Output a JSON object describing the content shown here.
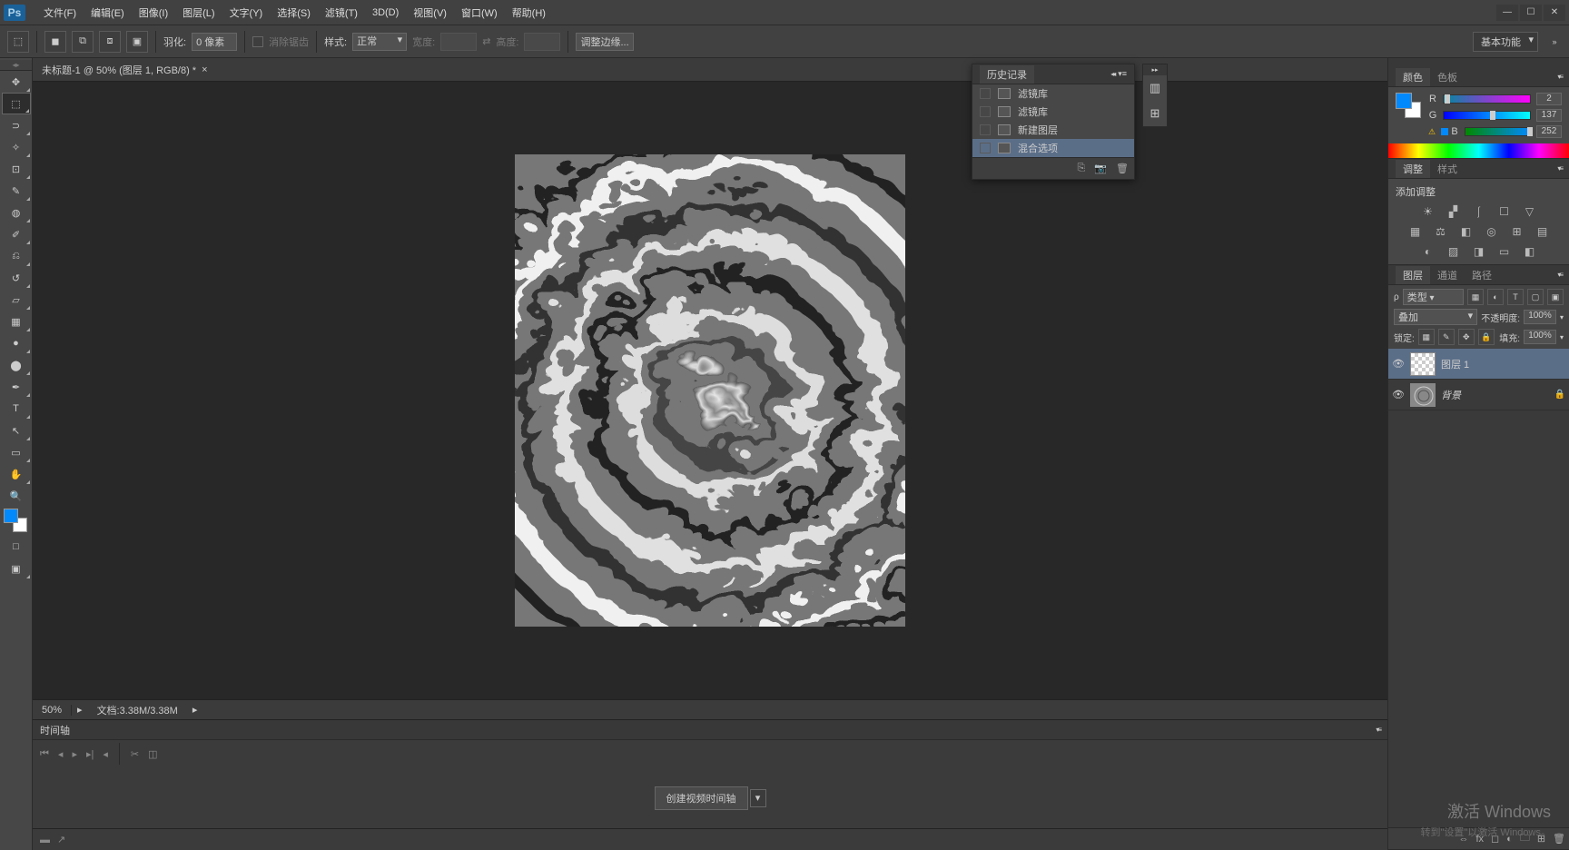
{
  "menu": {
    "items": [
      "文件(F)",
      "编辑(E)",
      "图像(I)",
      "图层(L)",
      "文字(Y)",
      "选择(S)",
      "滤镜(T)",
      "3D(D)",
      "视图(V)",
      "窗口(W)",
      "帮助(H)"
    ]
  },
  "window_controls": {
    "min": "—",
    "max": "☐",
    "close": "✕"
  },
  "options": {
    "feather_label": "羽化:",
    "feather_value": "0 像素",
    "antialias": "消除锯齿",
    "style_label": "样式:",
    "style_value": "正常",
    "width_label": "宽度:",
    "height_label": "高度:",
    "refine": "调整边缘...",
    "workspace": "基本功能"
  },
  "document": {
    "tab": "未标题-1 @ 50% (图层 1, RGB/8) *"
  },
  "status": {
    "zoom": "50%",
    "doc": "文档:3.38M/3.38M"
  },
  "timeline": {
    "title": "时间轴",
    "create": "创建视频时间轴"
  },
  "history": {
    "title": "历史记录",
    "items": [
      "滤镜库",
      "滤镜库",
      "新建图层",
      "混合选项"
    ],
    "selected": 3
  },
  "color": {
    "tab1": "颜色",
    "tab2": "色板",
    "r": "2",
    "g": "137",
    "b": "252"
  },
  "adjust": {
    "tab1": "调整",
    "tab2": "样式",
    "label": "添加调整"
  },
  "layers": {
    "tab1": "图层",
    "tab2": "通道",
    "tab3": "路径",
    "kind": "类型",
    "blend": "叠加",
    "opacity_label": "不透明度:",
    "opacity": "100%",
    "lock_label": "锁定:",
    "fill_label": "填充:",
    "fill": "100%",
    "items": [
      {
        "name": "图层 1",
        "selected": true,
        "thumb": "checker"
      },
      {
        "name": "背景",
        "locked": true,
        "thumb": "img",
        "italic": true
      }
    ]
  },
  "watermark": {
    "main": "激活 Windows",
    "sub": "转到\"设置\"以激活 Windows。"
  },
  "icons": {
    "marquee": "⬚",
    "move": "✥",
    "lasso": "⊃",
    "wand": "✧",
    "crop": "⊡",
    "eyedrop": "✎",
    "heal": "◍",
    "brush": "✐",
    "stamp": "⎌",
    "history_brush": "↺",
    "eraser": "▱",
    "gradient": "▦",
    "blur": "●",
    "dodge": "⬤",
    "pen": "✒",
    "type": "T",
    "path": "↖",
    "shape": "▭",
    "hand": "✋",
    "zoom": "🔍",
    "mask": "□",
    "screen": "▣"
  }
}
